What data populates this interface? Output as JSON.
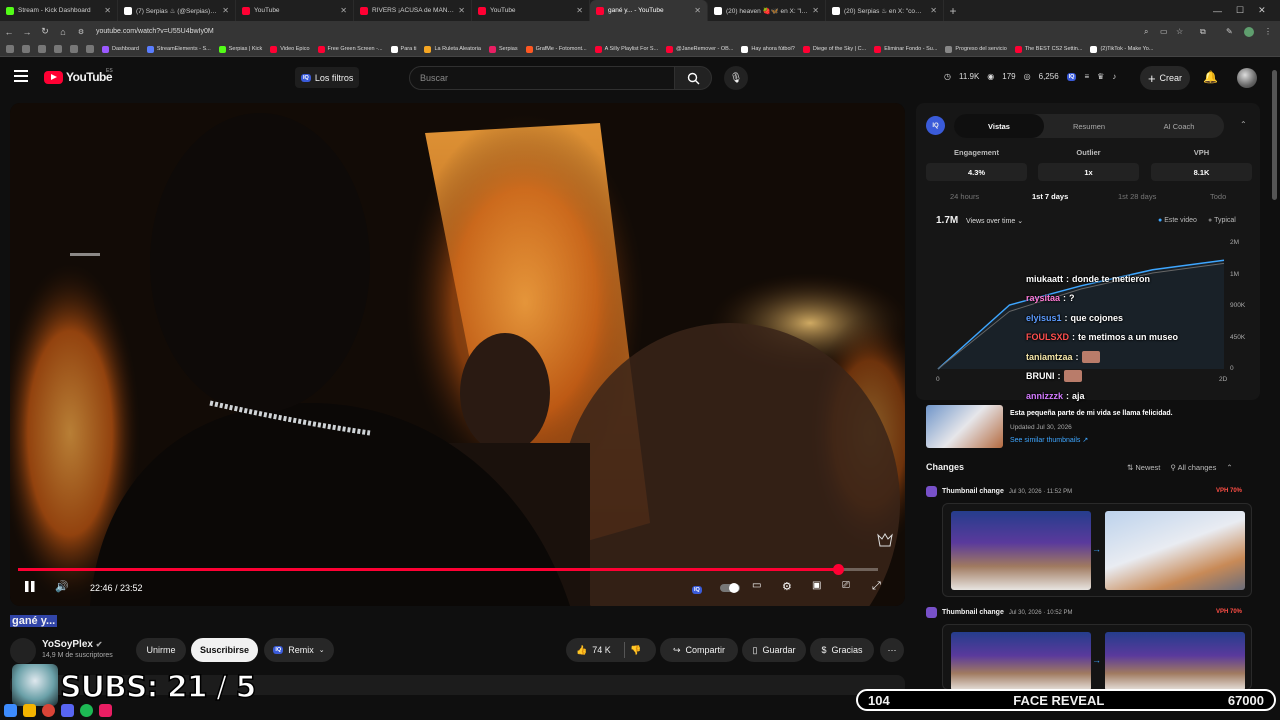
{
  "browser": {
    "tabs": [
      {
        "label": "Stream - Kick Dashboard",
        "color": "#53fc18",
        "active": false
      },
      {
        "label": "(7) Serpias ♨ (@Serpias) / X",
        "color": "#ffffff",
        "active": false
      },
      {
        "label": "YouTube",
        "color": "#ff0033",
        "active": false
      },
      {
        "label": "RIVERS ¡ACUSA de MANIPULAR",
        "color": "#ff0033",
        "active": false
      },
      {
        "label": "YouTube",
        "color": "#ff0033",
        "active": false
      },
      {
        "label": "gané y... - YouTube",
        "color": "#ff0033",
        "active": true
      },
      {
        "label": "(20) heaven 🍓🦋 en X: \"los lin",
        "color": "#ffffff",
        "active": false
      },
      {
        "label": "(20) Serpias ♨ en X: \"como la",
        "color": "#ffffff",
        "active": false
      }
    ],
    "url": "youtube.com/watch?v=U55U4bwIy0M",
    "bookmarks": [
      {
        "label": "Dashboard",
        "color": "#9b59ff"
      },
      {
        "label": "StreamElements - S...",
        "color": "#5a7dff"
      },
      {
        "label": "Serpias | Kick",
        "color": "#53fc18"
      },
      {
        "label": "Video Epico",
        "color": "#ff0033"
      },
      {
        "label": "Free Green Screen -...",
        "color": "#ff0033"
      },
      {
        "label": "Para ti",
        "color": "#ffffff"
      },
      {
        "label": "La Ruleta Aleatoria",
        "color": "#f5a623"
      },
      {
        "label": "Serpias",
        "color": "#e91e63"
      },
      {
        "label": "GrafMe - Fotomont...",
        "color": "#ff5722"
      },
      {
        "label": "A Silly Playlist For S...",
        "color": "#ff0033"
      },
      {
        "label": "@JaneRemover - OB...",
        "color": "#ff0033"
      },
      {
        "label": "Hay ahora fútbol?",
        "color": "#ffffff"
      },
      {
        "label": "Diege of the Sky | C...",
        "color": "#ff0033"
      },
      {
        "label": "Eliminar Fondo - Su...",
        "color": "#ff0033"
      },
      {
        "label": "Progreso del servicio",
        "color": "#888888"
      },
      {
        "label": "The BEST CS2 Settin...",
        "color": "#ff0033"
      },
      {
        "label": "(2)TikTok - Make Yo...",
        "color": "#ffffff"
      }
    ]
  },
  "yt": {
    "logo_text": "YouTube",
    "region": "ES",
    "filters_label": "Los filtros",
    "filters_badge": "IQ",
    "search_placeholder": "Buscar",
    "stats": {
      "watch": "11.9K",
      "views": "179",
      "eye": "6,256"
    },
    "create_label": "Crear"
  },
  "player": {
    "time": "22:46 / 23:52",
    "progress": 0.954
  },
  "video": {
    "title": "gané y...",
    "channel": "YoSoyPlex",
    "subscribers": "14,9 M de suscriptores",
    "join_label": "Unirme",
    "subscribe_label": "Suscribirse",
    "remix_label": "Remix",
    "likes": "74 K",
    "share_label": "Compartir",
    "save_label": "Guardar",
    "thanks_label": "Gracias"
  },
  "vidiq": {
    "badge": "IQ",
    "tabs": [
      "Vistas",
      "Resumen",
      "AI Coach"
    ],
    "metrics": [
      {
        "label": "Engagement",
        "value": "4.3%"
      },
      {
        "label": "Outlier",
        "value": "1x"
      },
      {
        "label": "VPH",
        "value": "8.1K"
      }
    ],
    "ranges": [
      "24 hours",
      "1st 7 days",
      "1st 28 days",
      "Todo"
    ],
    "total": "1.7M",
    "dropdown": "Views over time",
    "legend_this": "Este video",
    "legend_typical": "Typical",
    "accent": "#3ea6ff"
  },
  "chart_data": {
    "type": "line",
    "x_ticks": [
      "0",
      "2D"
    ],
    "y_ticks": [
      "2M",
      "1M",
      "900K",
      "450K",
      "0"
    ],
    "series": [
      {
        "name": "Este video",
        "x": [
          0,
          0.5,
          1,
          1.5,
          2
        ],
        "y": [
          0,
          1000000,
          1300000,
          1550000,
          1700000
        ]
      },
      {
        "name": "Typical",
        "x": [
          0,
          0.5,
          1,
          1.5,
          2
        ],
        "y": [
          0,
          900000,
          1250000,
          1500000,
          1650000
        ]
      }
    ]
  },
  "chat": [
    {
      "user": "miukaatt",
      "msg": "donde te metieron",
      "color": "#ffffff"
    },
    {
      "user": "raysitaa",
      "msg": "?",
      "color": "#ff7bd5"
    },
    {
      "user": "elyisus1",
      "msg": "que cojones",
      "color": "#5b9bff"
    },
    {
      "user": "FOULSXD",
      "msg": "te metimos a un museo",
      "color": "#ff4f4f"
    },
    {
      "user": "taniamtzaa",
      "msg": "",
      "color": "#f4e6a8"
    },
    {
      "user": "BRUNI",
      "msg": "",
      "color": "#ffffff"
    },
    {
      "user": "annizzzk",
      "msg": "aja",
      "color": "#d37bff"
    }
  ],
  "thumbinfo": {
    "title": "Esta pequeña parte de mi vida se llama felicidad.",
    "date": "Updated Jul 30, 2026",
    "link": "See similar thumbnails ↗"
  },
  "changes": {
    "header": "Changes",
    "sort": "Newest",
    "filter": "All changes",
    "items": [
      {
        "label": "Thumbnail change",
        "date": "Jul 30, 2026 · 11:52 PM",
        "vph": "VPH 70%"
      },
      {
        "label": "Thumbnail change",
        "date": "Jul 30, 2026 · 10:52 PM",
        "vph": "VPH 70%"
      }
    ]
  },
  "overlay": {
    "subs": "SUBS: 21 / 5",
    "goal_left": "104",
    "goal_title": "FACE REVEAL",
    "goal_right": "67000"
  }
}
